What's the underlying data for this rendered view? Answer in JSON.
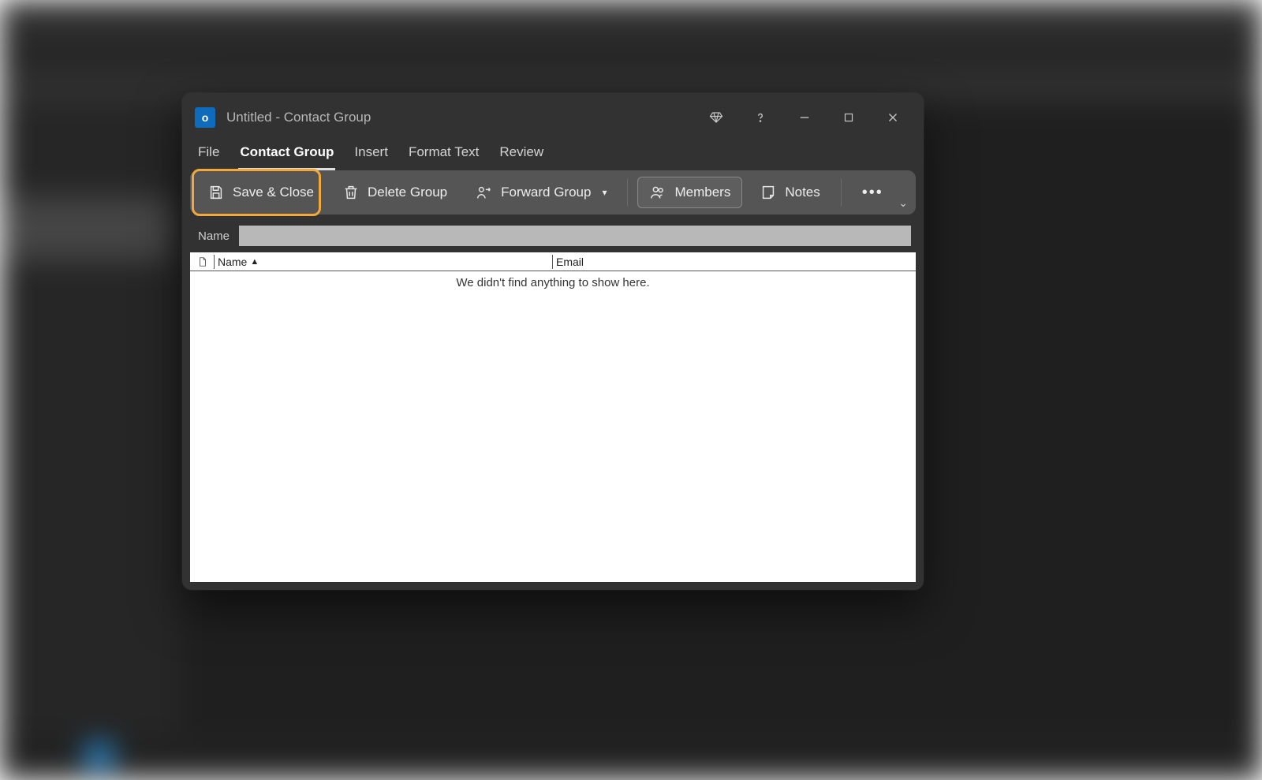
{
  "window": {
    "doc_title": "Untitled",
    "separator": "  -  ",
    "type_label": "Contact Group"
  },
  "tabs": [
    {
      "label": "File"
    },
    {
      "label": "Contact Group"
    },
    {
      "label": "Insert"
    },
    {
      "label": "Format Text"
    },
    {
      "label": "Review"
    }
  ],
  "active_tab_index": 1,
  "ribbon": {
    "save_close": "Save & Close",
    "delete_group": "Delete Group",
    "forward_group": "Forward Group",
    "members": "Members",
    "notes": "Notes"
  },
  "name_field": {
    "label": "Name",
    "value": ""
  },
  "columns": {
    "name": "Name",
    "email": "Email"
  },
  "empty_message": "We didn't find anything to show here.",
  "colors": {
    "accent": "#0f6cbd",
    "highlight": "#f0a93a"
  }
}
